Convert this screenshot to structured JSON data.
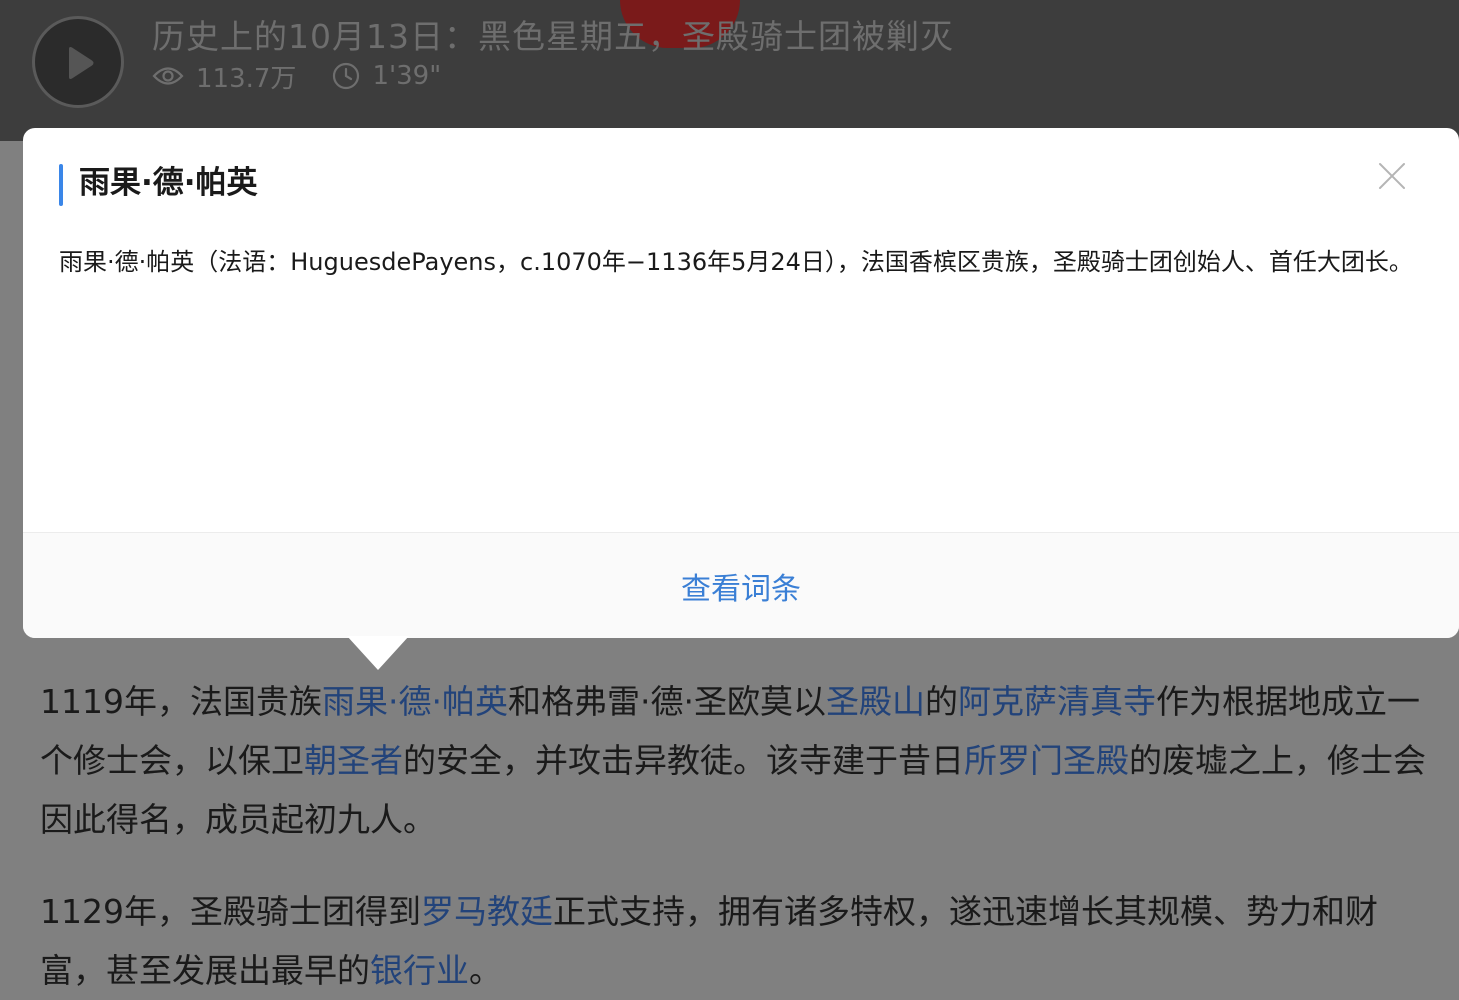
{
  "video": {
    "title": "历史上的10月13日：黑色星期五，圣殿骑士团被剿灭",
    "views": "113.7万",
    "duration": "1'39\""
  },
  "popup": {
    "title": "雨果·德·帕英",
    "description": "雨果·德·帕英（法语：HuguesdePayens，c.1070年−1136年5月24日），法国香槟区贵族，圣殿骑士团创始人、首任大团长。",
    "view_entry_label": "查看词条"
  },
  "article": {
    "p1": {
      "t1": "1119年，法国贵族",
      "link1": "雨果·德·帕英",
      "t2": "和格弗雷·德·圣欧莫以",
      "link2": "圣殿山",
      "t3": "的",
      "link3": "阿克萨清真寺",
      "t4": "作为根据地成立一个修士会，以保卫",
      "link4": "朝圣者",
      "t5": "的安全，并攻击异教徒。该寺建于昔日",
      "link5": "所罗门圣殿",
      "t6": "的废墟之上，修士会因此得名，成员起初九人。"
    },
    "p2": {
      "t1": "1129年，圣殿骑士团得到",
      "link1": "罗马教廷",
      "t2": "正式支持，拥有诸多特权，遂迅速增长其规模、势力和财富，甚至发展出最早的",
      "link2": "银行业",
      "t3": "。"
    }
  },
  "colors": {
    "overlay_bg": "#808080",
    "accent_blue": "#3a86e8",
    "link_blue": "#3a7fd5"
  },
  "icons": [
    "play-icon",
    "eye-icon",
    "clock-icon",
    "close-icon"
  ]
}
